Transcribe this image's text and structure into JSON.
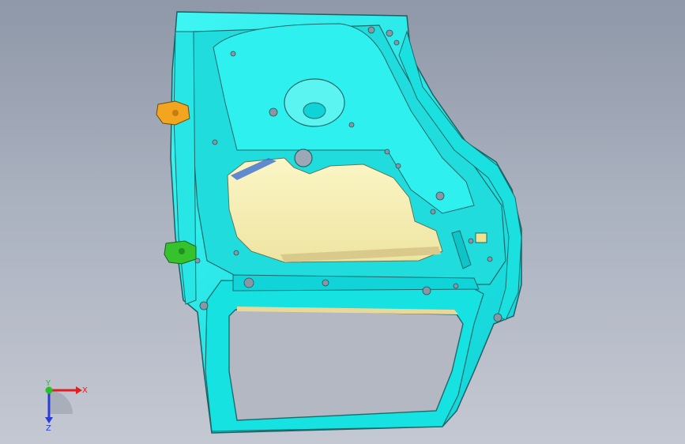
{
  "viewport": {
    "background_top": "#8f98a8",
    "background_bottom": "#c4c8d2"
  },
  "model": {
    "panel_color": "#12e8e8",
    "window_fill_color": "#f6f0b4",
    "hinge_upper_color": "#f3a51f",
    "hinge_lower_color": "#35c22c",
    "edge_color": "#2a6b6b"
  },
  "triad": {
    "x_label": "X",
    "y_label": "Y",
    "z_label": "Z",
    "x_color": "#e02020",
    "y_color": "#22c322",
    "z_color": "#2a3cd8"
  }
}
